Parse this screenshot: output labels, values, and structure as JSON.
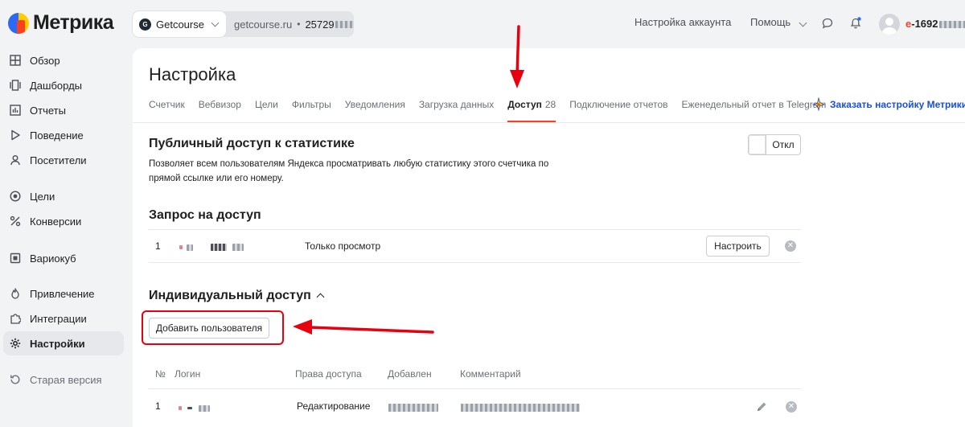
{
  "app": {
    "logo_text": "Метрика"
  },
  "counter": {
    "name": "Getcourse",
    "icon_text": "G",
    "site": "getcourse.ru",
    "separator": "•",
    "id_visible": "25729"
  },
  "topbar": {
    "account_settings": "Настройка аккаунта",
    "help": "Помощь",
    "user_login_visible": "e-1692",
    "user_login_first": "e",
    "user_login_rest": "-1692"
  },
  "sidebar": {
    "items": [
      {
        "label": "Обзор",
        "icon": "grid-icon"
      },
      {
        "label": "Дашборды",
        "icon": "dashboards-icon"
      },
      {
        "label": "Отчеты",
        "icon": "reports-icon"
      },
      {
        "label": "Поведение",
        "icon": "play-icon"
      },
      {
        "label": "Посетители",
        "icon": "person-icon"
      },
      {
        "label": "Цели",
        "icon": "target-icon"
      },
      {
        "label": "Конверсии",
        "icon": "percent-icon"
      },
      {
        "label": "Вариокуб",
        "icon": "cube-icon"
      },
      {
        "label": "Привлечение",
        "icon": "flame-icon"
      },
      {
        "label": "Интеграции",
        "icon": "puzzle-icon"
      },
      {
        "label": "Настройки",
        "icon": "gear-icon"
      },
      {
        "label": "Старая версия",
        "icon": "history-icon"
      }
    ]
  },
  "page": {
    "title": "Настройка",
    "tabs": [
      {
        "label": "Счетчик"
      },
      {
        "label": "Вебвизор"
      },
      {
        "label": "Цели"
      },
      {
        "label": "Фильтры"
      },
      {
        "label": "Уведомления"
      },
      {
        "label": "Загрузка данных"
      },
      {
        "label": "Доступ",
        "count": "28"
      },
      {
        "label": "Подключение отчетов"
      },
      {
        "label": "Еженедельный отчет в Telegram"
      }
    ],
    "order_link": "Заказать настройку Метрики"
  },
  "public_access": {
    "title": "Публичный доступ к статистике",
    "description": "Позволяет всем пользователям Яндекса просматривать любую статистику этого счетчика по прямой ссылке или его номеру.",
    "toggle_label": "Откл"
  },
  "access_request": {
    "title": "Запрос на доступ",
    "rows": [
      {
        "num": "1",
        "rights": "Только просмотр",
        "action": "Настроить"
      }
    ]
  },
  "individual_access": {
    "title": "Индивидуальный доступ",
    "add_button": "Добавить пользователя",
    "columns": [
      "№",
      "Логин",
      "Права доступа",
      "Добавлен",
      "Комментарий"
    ],
    "rows": [
      {
        "num": "1",
        "rights": "Редактирование"
      }
    ]
  },
  "colors": {
    "accent_red": "#fc3f1d",
    "link_blue": "#1a4fd8",
    "annotation_red": "#e8000f"
  }
}
